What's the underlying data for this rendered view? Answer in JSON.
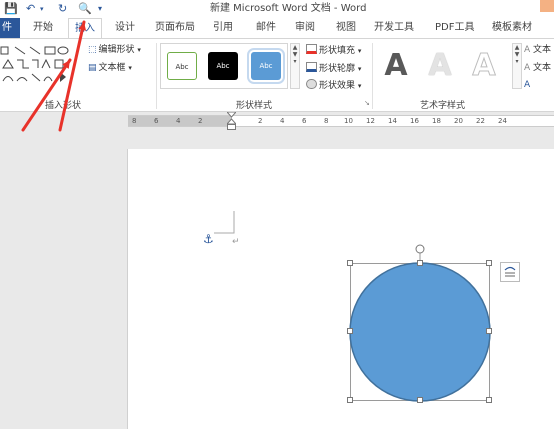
{
  "window": {
    "title": "新建 Microsoft Word 文档 - Word"
  },
  "tabs": [
    {
      "label": "件"
    },
    {
      "label": "开始"
    },
    {
      "label": "插入"
    },
    {
      "label": "设计"
    },
    {
      "label": "页面布局"
    },
    {
      "label": "引用"
    },
    {
      "label": "邮件"
    },
    {
      "label": "审阅"
    },
    {
      "label": "视图"
    },
    {
      "label": "开发工具"
    },
    {
      "label": "PDF工具"
    },
    {
      "label": "模板素材"
    }
  ],
  "ribbon": {
    "insert_shapes": {
      "label": "插入形状",
      "edit_shape": "编辑形状",
      "text_box": "文本框"
    },
    "shape_styles": {
      "label": "形状样式",
      "samples": [
        "Abc",
        "Abc",
        "Abc"
      ],
      "fill": "形状填充",
      "outline": "形状轮廓",
      "effects": "形状效果"
    },
    "wordart_styles": {
      "label": "艺术字样式",
      "samples": [
        "A",
        "A",
        "A"
      ],
      "cmd1": "文本",
      "cmd2": "文本"
    }
  },
  "ruler": {
    "marks": [
      "8",
      "6",
      "4",
      "2",
      "2",
      "4",
      "6",
      "8",
      "10",
      "12",
      "14",
      "16",
      "18",
      "20",
      "22",
      "24"
    ]
  },
  "colors": {
    "brand": "#2b579a",
    "circle_fill": "#5b9bd5",
    "circle_stroke": "#41719c",
    "annotation_arrow": "#e8322a"
  }
}
